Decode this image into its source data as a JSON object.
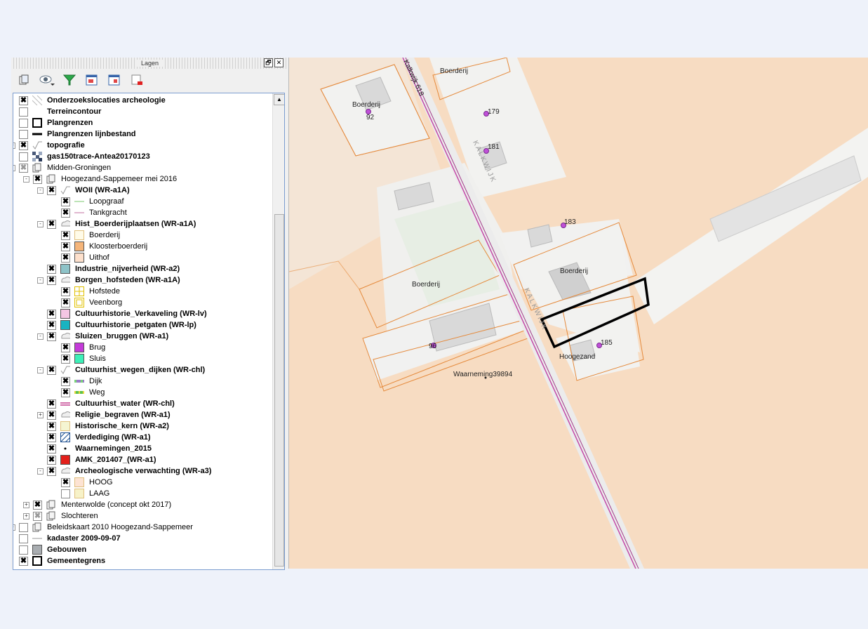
{
  "panel": {
    "title": "Lagen",
    "float_btn": "🗗",
    "close_btn": "✕",
    "scroll_up": "▲"
  },
  "toolbar": {
    "add_group_icon": "add-group-icon",
    "visibility_icon": "eye-icon",
    "filter_icon": "filter-icon",
    "expand_icon": "expand-all-icon",
    "collapse_icon": "collapse-all-icon",
    "remove_icon": "remove-layer-icon"
  },
  "layers": [
    {
      "label": "Onderzoekslocaties archeologie",
      "bold": true,
      "checked": true,
      "indent": 0,
      "sym": "hatch"
    },
    {
      "label": "Terreincontour",
      "bold": true,
      "checked": false,
      "indent": 0,
      "sym": "none"
    },
    {
      "label": "Plangrenzen",
      "bold": true,
      "checked": false,
      "indent": 0,
      "sym": "box-black"
    },
    {
      "label": "Plangrenzen lijnbestand",
      "bold": true,
      "checked": false,
      "indent": 0,
      "sym": "line-black"
    },
    {
      "label": "topografie",
      "bold": true,
      "checked": true,
      "indent": 0,
      "sym": "vector",
      "expander": "+"
    },
    {
      "label": "gas150trace-Antea20170123",
      "bold": true,
      "checked": false,
      "indent": 0,
      "sym": "raster"
    },
    {
      "label": "Midden-Groningen",
      "bold": false,
      "checked": "dis",
      "indent": 0,
      "sym": "group",
      "expander": "-"
    },
    {
      "label": "Hoogezand-Sappemeer mei 2016",
      "bold": false,
      "checked": true,
      "indent": 1,
      "sym": "group",
      "expander": "-"
    },
    {
      "label": "WOII (WR-a1A)",
      "bold": true,
      "checked": true,
      "indent": 2,
      "sym": "vector",
      "expander": "-"
    },
    {
      "label": "Loopgraaf",
      "bold": false,
      "checked": true,
      "indent": 3,
      "sym": "line-green"
    },
    {
      "label": "Tankgracht",
      "bold": false,
      "checked": true,
      "indent": 3,
      "sym": "line-pink"
    },
    {
      "label": "Hist_Boerderijplaatsen (WR-a1A)",
      "bold": true,
      "checked": true,
      "indent": 2,
      "sym": "cloud",
      "expander": "-"
    },
    {
      "label": "Boerderij",
      "bold": false,
      "checked": true,
      "indent": 3,
      "sym": "fill-cream"
    },
    {
      "label": "Kloosterboerderij",
      "bold": false,
      "checked": true,
      "indent": 3,
      "sym": "fill-orange"
    },
    {
      "label": "Uithof",
      "bold": false,
      "checked": true,
      "indent": 3,
      "sym": "fill-peach"
    },
    {
      "label": "Industrie_nijverheid (WR-a2)",
      "bold": true,
      "checked": true,
      "indent": 2,
      "sym": "fill-teal"
    },
    {
      "label": "Borgen_hofsteden (WR-a1A)",
      "bold": true,
      "checked": true,
      "indent": 2,
      "sym": "cloud",
      "expander": "-"
    },
    {
      "label": "Hofstede",
      "bold": false,
      "checked": true,
      "indent": 3,
      "sym": "fill-yellowgrid"
    },
    {
      "label": "Veenborg",
      "bold": false,
      "checked": true,
      "indent": 3,
      "sym": "fill-yellowgrid2"
    },
    {
      "label": "Cultuurhistorie_Verkaveling (WR-lv)",
      "bold": true,
      "checked": true,
      "indent": 2,
      "sym": "fill-pink"
    },
    {
      "label": "Cultuurhistorie_petgaten (WR-lp)",
      "bold": true,
      "checked": true,
      "indent": 2,
      "sym": "fill-cyan"
    },
    {
      "label": "Sluizen_bruggen (WR-a1)",
      "bold": true,
      "checked": true,
      "indent": 2,
      "sym": "cloud",
      "expander": "-"
    },
    {
      "label": "Brug",
      "bold": false,
      "checked": true,
      "indent": 3,
      "sym": "fill-purple"
    },
    {
      "label": "Sluis",
      "bold": false,
      "checked": true,
      "indent": 3,
      "sym": "fill-mint"
    },
    {
      "label": "Cultuurhist_wegen_dijken (WR-chl)",
      "bold": true,
      "checked": true,
      "indent": 2,
      "sym": "vector",
      "expander": "-"
    },
    {
      "label": "Dijk",
      "bold": false,
      "checked": true,
      "indent": 3,
      "sym": "line-dijk"
    },
    {
      "label": "Weg",
      "bold": false,
      "checked": true,
      "indent": 3,
      "sym": "line-weg"
    },
    {
      "label": "Cultuurhist_water (WR-chl)",
      "bold": true,
      "checked": true,
      "indent": 2,
      "sym": "line-water"
    },
    {
      "label": "Religie_begraven (WR-a1)",
      "bold": true,
      "checked": true,
      "indent": 2,
      "sym": "cloud",
      "expander": "+"
    },
    {
      "label": "Historische_kern (WR-a2)",
      "bold": true,
      "checked": true,
      "indent": 2,
      "sym": "fill-lightyellow"
    },
    {
      "label": "Verdediging (WR-a1)",
      "bold": true,
      "checked": true,
      "indent": 2,
      "sym": "hatch-blue"
    },
    {
      "label": "Waarnemingen_2015",
      "bold": true,
      "checked": true,
      "indent": 2,
      "sym": "dot"
    },
    {
      "label": "AMK_201407_(WR-a1)",
      "bold": true,
      "checked": true,
      "indent": 2,
      "sym": "fill-red"
    },
    {
      "label": "Archeologische verwachting (WR-a3)",
      "bold": true,
      "checked": true,
      "indent": 2,
      "sym": "cloud",
      "expander": "-"
    },
    {
      "label": "HOOG",
      "bold": false,
      "checked": true,
      "indent": 3,
      "sym": "fill-peach2"
    },
    {
      "label": "LAAG",
      "bold": false,
      "checked": false,
      "indent": 3,
      "sym": "fill-lightyellow2"
    },
    {
      "label": "Menterwolde (concept okt 2017)",
      "bold": false,
      "checked": true,
      "indent": 1,
      "sym": "group",
      "expander": "+"
    },
    {
      "label": "Slochteren",
      "bold": false,
      "checked": "dis",
      "indent": 1,
      "sym": "group",
      "expander": "+"
    },
    {
      "label": "Beleidskaart 2010 Hoogezand-Sappemeer",
      "bold": false,
      "checked": false,
      "indent": 0,
      "sym": "group",
      "expander": "+"
    },
    {
      "label": "kadaster 2009-09-07",
      "bold": true,
      "checked": false,
      "indent": 0,
      "sym": "line-thin"
    },
    {
      "label": "Gebouwen",
      "bold": true,
      "checked": false,
      "indent": 0,
      "sym": "fill-grey"
    },
    {
      "label": "Gemeentegrens",
      "bold": true,
      "checked": true,
      "indent": 0,
      "sym": "box-black"
    }
  ],
  "symbol_colors": {
    "fill-cream": "#fffbe8",
    "fill-orange": "#f5b57a",
    "fill-peach": "#fde0cc",
    "fill-teal": "#8ec3c8",
    "fill-pink": "#f4c6e3",
    "fill-cyan": "#19b3c1",
    "fill-purple": "#c43bd9",
    "fill-mint": "#3df0b8",
    "fill-lightyellow": "#f5f5d2",
    "fill-red": "#e3201b",
    "fill-peach2": "#fde3d3",
    "fill-lightyellow2": "#f7f2c8",
    "fill-grey": "#a9adb1"
  },
  "map": {
    "street_label": "Kalkwijk 618",
    "street_label_2": "KALKWIJK",
    "labels": [
      {
        "text": "Boerderij",
        "id": "boerderij-1"
      },
      {
        "text": "Boerderij",
        "id": "boerderij-2"
      },
      {
        "text": "92",
        "id": "num-92"
      },
      {
        "text": "179",
        "id": "num-179"
      },
      {
        "text": "181",
        "id": "num-181"
      },
      {
        "text": "183",
        "id": "num-183"
      },
      {
        "text": "Boerderij",
        "id": "boerderij-3"
      },
      {
        "text": "Boerderij",
        "id": "boerderij-4"
      },
      {
        "text": "96",
        "id": "num-96"
      },
      {
        "text": "185",
        "id": "num-185"
      },
      {
        "text": "Hoogezand",
        "id": "hoogezand"
      },
      {
        "text": "Waarneming39894",
        "id": "waarneming"
      }
    ]
  }
}
